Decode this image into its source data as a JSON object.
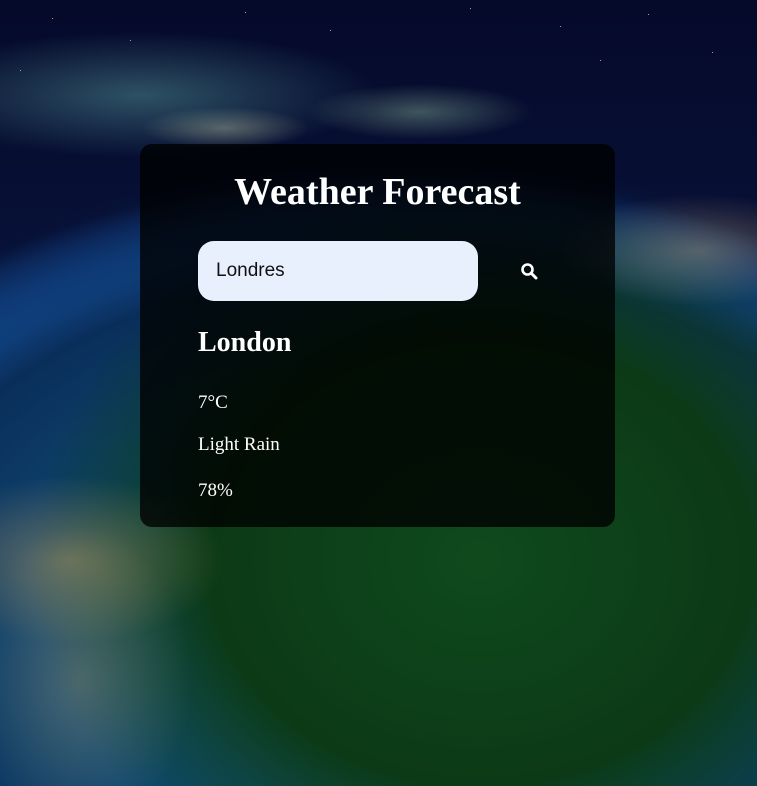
{
  "app": {
    "title": "Weather Forecast"
  },
  "search": {
    "value": "Londres",
    "button_icon": "search-icon"
  },
  "weather": {
    "city": "London",
    "temperature": "7°C",
    "description": "Light Rain",
    "humidity": "78%"
  },
  "colors": {
    "card_background": "#000000",
    "input_background": "#e8f0fe",
    "text": "#ffffff"
  }
}
